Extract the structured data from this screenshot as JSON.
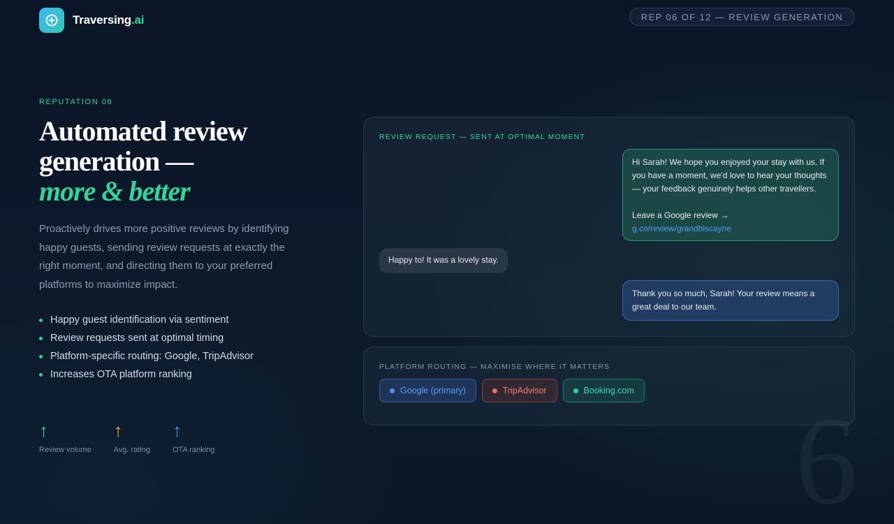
{
  "brand": {
    "name": "Traversing",
    "suffix": ".ai",
    "logo_icon": "plus-circle-icon"
  },
  "rep_pill": "REP 06 OF 12 — REVIEW GENERATION",
  "hero": {
    "eyebrow": "REPUTATION 06",
    "headline_line1": "Automated review",
    "headline_line2": "generation —",
    "headline_accent": "more & better",
    "lede": "Proactively drives more positive reviews by identifying happy guests, sending review requests at exactly the right moment, and directing them to your preferred platforms to maximize impact.",
    "bullets": [
      "Happy guest identification via sentiment",
      "Review requests sent at optimal timing",
      "Platform-specific routing: Google, TripAdvisor",
      "Increases OTA platform ranking"
    ]
  },
  "metrics": [
    {
      "label": "Review volume",
      "arrow": "↑",
      "color": "#34d399"
    },
    {
      "label": "Avg. rating",
      "arrow": "↑",
      "color": "#f5a623"
    },
    {
      "label": "OTA ranking",
      "arrow": "↑",
      "color": "#4f8ff0"
    }
  ],
  "chat": {
    "title": "REVIEW REQUEST — SENT AT OPTIMAL MOMENT",
    "hotel_message": "Hi Sarah! We hope you enjoyed your stay with us. If you have a moment, we'd love to hear your thoughts — your feedback genuinely helps other travellers.",
    "cta": "Leave a Google review →",
    "link": "g.co/review/grandbiscayne",
    "guest_reply": "Happy to! It was a lovely stay.",
    "hotel_thanks": "Thank you so much, Sarah! Your review means a great deal to our team."
  },
  "routing": {
    "title": "PLATFORM ROUTING — MAXIMISE WHERE IT MATTERS",
    "chips": [
      "Google (primary)",
      "TripAdvisor",
      "Booking.com"
    ]
  },
  "slide_number": "6",
  "colors": {
    "accent": "#34d399",
    "background": "#0c1526"
  }
}
